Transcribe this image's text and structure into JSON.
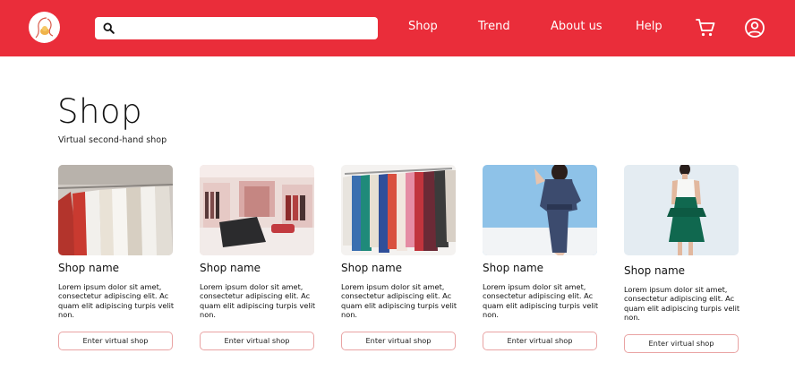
{
  "header": {
    "logo_icon": "mother-and-baby-logo",
    "search": {
      "placeholder": "",
      "value": "",
      "icon": "search-icon"
    },
    "nav": [
      "Shop",
      "Trend",
      "About us",
      "Help"
    ],
    "cart_icon": "shopping-cart-icon",
    "user_icon": "user-profile-icon",
    "background_color": "#ea2d3a"
  },
  "page": {
    "title": "Shop",
    "subtitle": "Virtual second-hand shop"
  },
  "shops": [
    {
      "name": "Shop name",
      "description": "Lorem ipsum dolor sit amet, consectetur adipiscing elit. Ac quam elit adipiscing turpis velit non.",
      "button": "Enter virtual shop",
      "image": "clothes-rack-photo"
    },
    {
      "name": "Shop name",
      "description": "Lorem ipsum dolor sit amet, consectetur adipiscing elit. Ac quam elit adipiscing turpis velit non.",
      "button": "Enter virtual shop",
      "image": "boutique-interior-photo"
    },
    {
      "name": "Shop name",
      "description": "Lorem ipsum dolor sit amet, consectetur adipiscing elit. Ac quam elit adipiscing turpis velit non.",
      "button": "Enter virtual shop",
      "image": "colorful-clothes-rack-photo"
    },
    {
      "name": "Shop name",
      "description": "Lorem ipsum dolor sit amet, consectetur adipiscing elit. Ac quam elit adipiscing turpis velit non.",
      "button": "Enter virtual shop",
      "image": "denim-jumpsuit-model-photo"
    },
    {
      "name": "Shop name",
      "description": "Lorem ipsum dolor sit amet, consectetur adipiscing elit. Ac quam elit adipiscing turpis velit non.",
      "button": "Enter virtual shop",
      "image": "green-skirt-model-photo"
    }
  ]
}
